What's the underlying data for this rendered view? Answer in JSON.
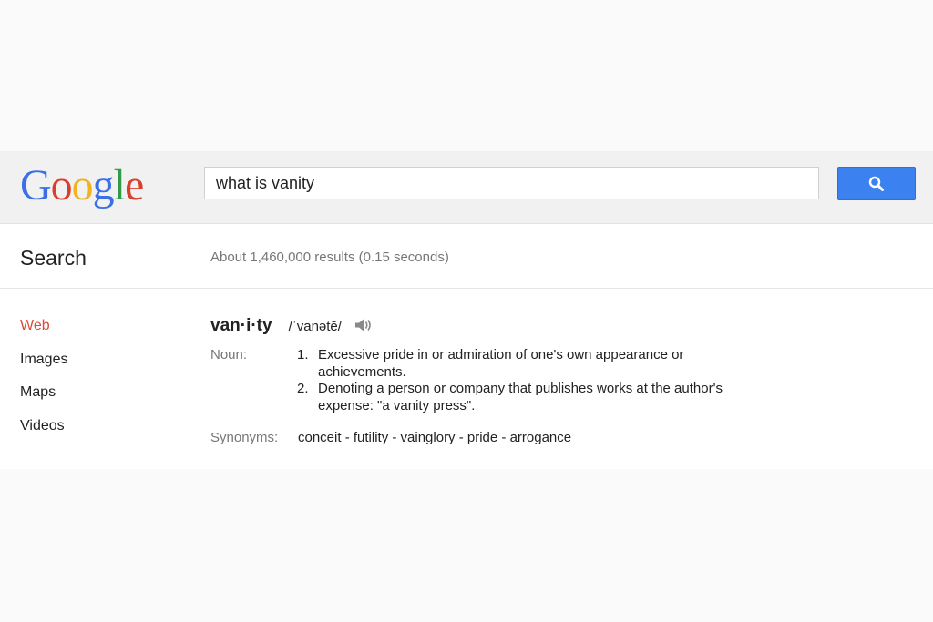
{
  "logo": {
    "letters": [
      {
        "char": "G",
        "color": "#3b6ee8"
      },
      {
        "char": "o",
        "color": "#d93f2f"
      },
      {
        "char": "o",
        "color": "#f2b21b"
      },
      {
        "char": "g",
        "color": "#3b6ee8"
      },
      {
        "char": "l",
        "color": "#2f9b48"
      },
      {
        "char": "e",
        "color": "#d93f2f"
      }
    ]
  },
  "search": {
    "query": "what is vanity",
    "button_icon": "search-icon"
  },
  "section_title": "Search",
  "result_stats": "About 1,460,000 results (0.15 seconds)",
  "nav": {
    "items": [
      {
        "label": "Web",
        "active": true
      },
      {
        "label": "Images",
        "active": false
      },
      {
        "label": "Maps",
        "active": false
      },
      {
        "label": "Videos",
        "active": false
      }
    ]
  },
  "definition": {
    "word": "van·i·ty",
    "phonetic": "/ˈvanətē/",
    "speaker_icon": "speaker-icon",
    "part_of_speech": "Noun:",
    "senses": [
      {
        "num": "1.",
        "text": "Excessive pride in or admiration of one's own appearance or achievements."
      },
      {
        "num": "2.",
        "text": "Denoting a person or company that publishes works at the author's expense: \"a vanity press\"."
      }
    ],
    "synonyms_label": "Synonyms:",
    "synonyms": "conceit - futility - vainglory - pride - arrogance"
  },
  "colors": {
    "accent": "#3b82f0",
    "active_nav": "#dd4b39"
  }
}
